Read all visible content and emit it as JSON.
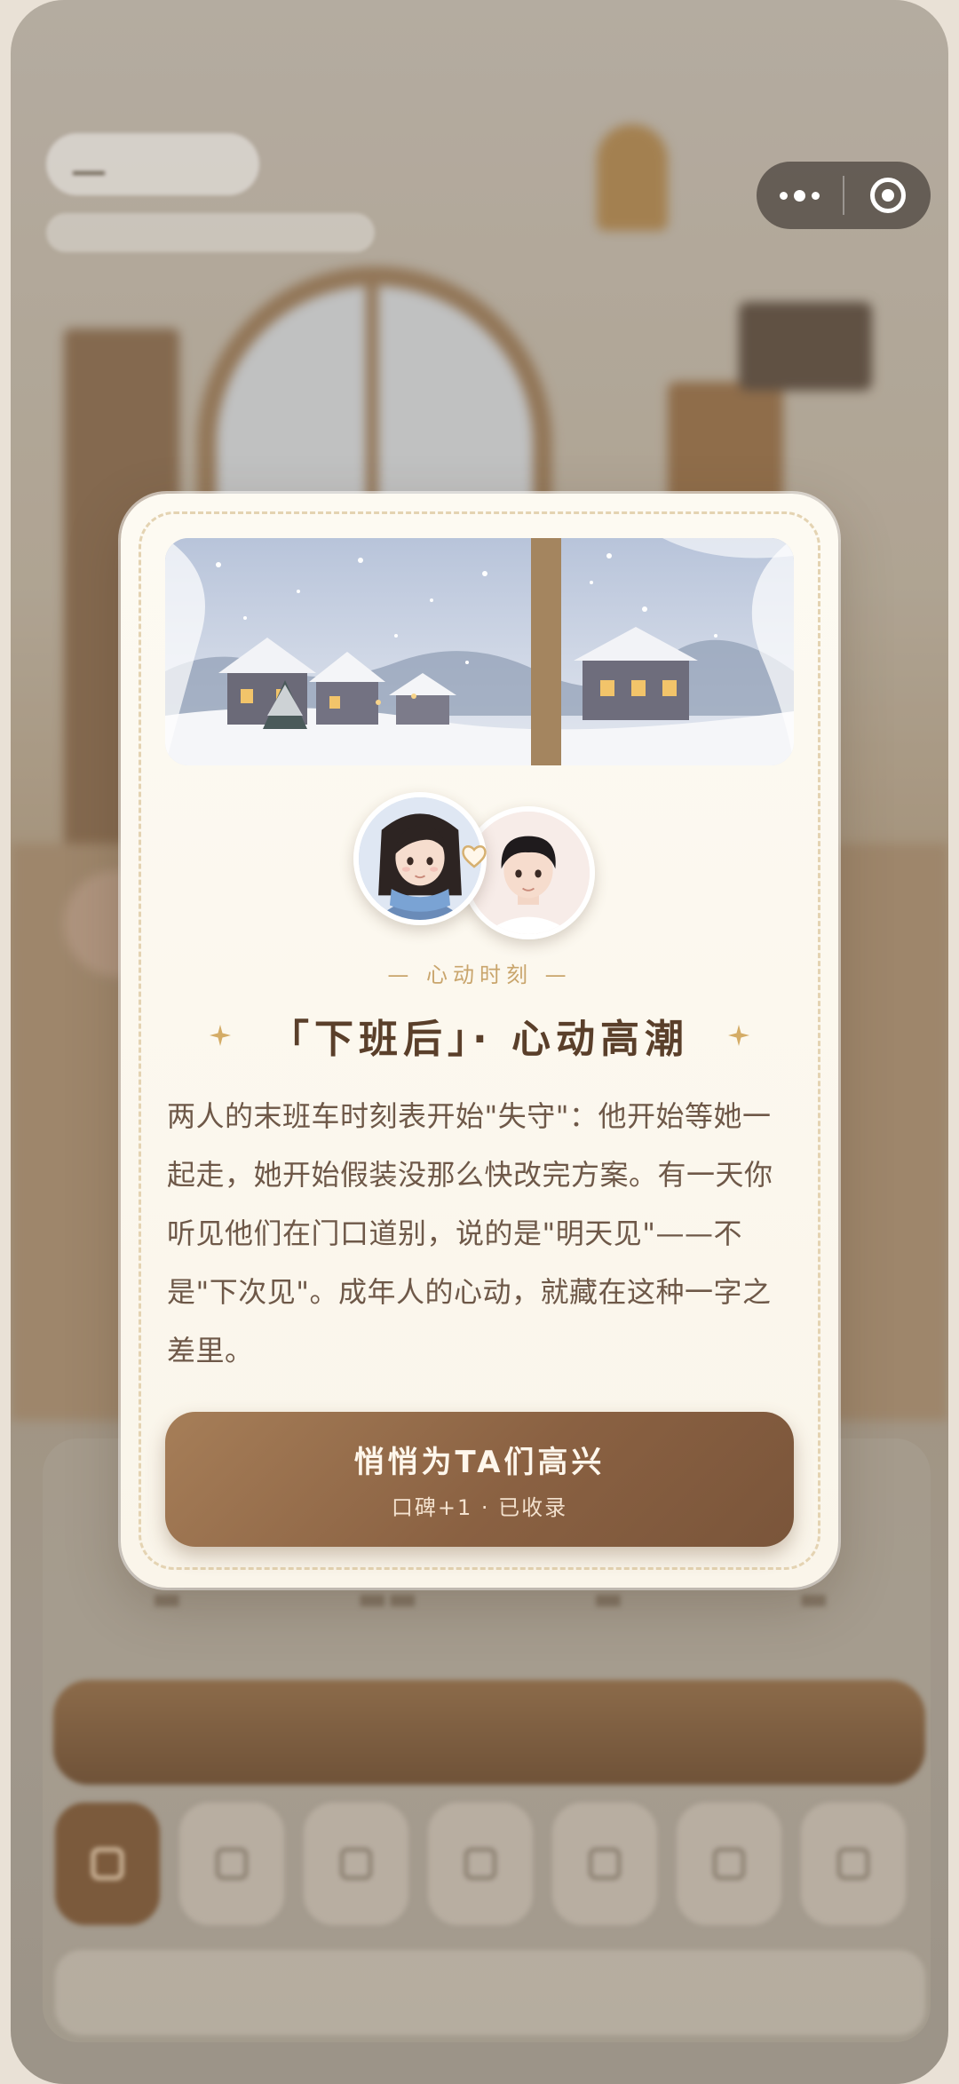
{
  "modal": {
    "eyebrow": "— 心动时刻 —",
    "title": "「下班后」· 心动高潮",
    "body": "两人的末班车时刻表开始\"失守\"：他开始等她一起走，她开始假装没那么快改完方案。有一天你听见他们在门口道别，说的是\"明天见\"——不是\"下次见\"。成年人的心动，就藏在这种一字之差里。",
    "cta_label": "悄悄为TA们高兴",
    "cta_sub": "口碑+1 · 已收录",
    "avatars": [
      "girl-avatar",
      "boy-avatar"
    ],
    "accent_color": "#c9a56c",
    "button_color": "#8a6142"
  },
  "capsule": {
    "more_icon": "more-dots-icon",
    "close_icon": "target-icon"
  },
  "colors": {
    "card_background": "#fdfaf2",
    "title_color": "#5a3f2a",
    "text_color": "#6e5848"
  }
}
